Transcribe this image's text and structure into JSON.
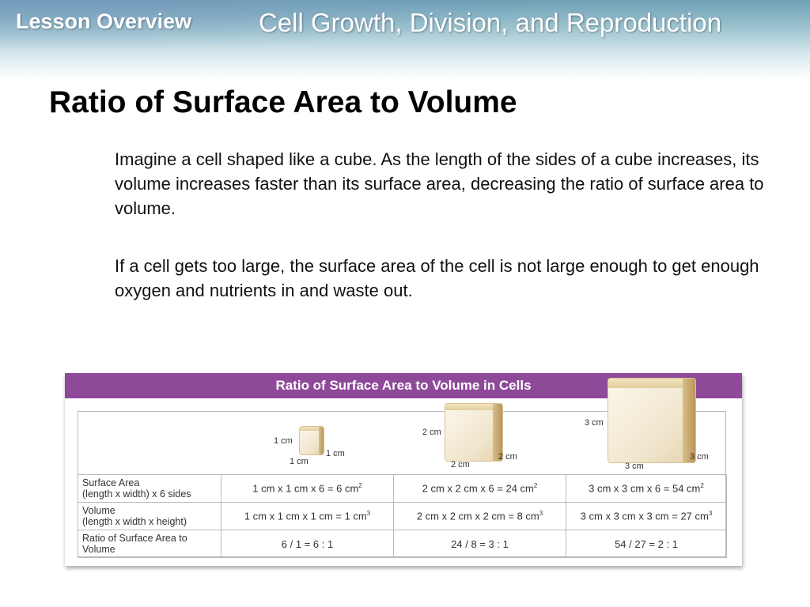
{
  "banner": {
    "left": "Lesson Overview",
    "right": "Cell Growth, Division, and Reproduction"
  },
  "slide": {
    "title": "Ratio of Surface Area to Volume",
    "paragraphs": [
      "Imagine a cell shaped like a cube. As the length of the sides of a cube increases, its volume increases faster than its surface area, decreasing the ratio of surface area to volume.",
      "If a cell gets too large, the surface area of the cell is not large enough to get enough oxygen and nutrients in and waste out."
    ]
  },
  "figure": {
    "title": "Ratio of Surface Area to Volume in Cells",
    "cubes": [
      {
        "side": "1 cm",
        "front": "1 cm",
        "bottom": "1 cm"
      },
      {
        "side": "2 cm",
        "front": "2 cm",
        "bottom": "2 cm"
      },
      {
        "side": "3 cm",
        "front": "3 cm",
        "bottom": "3 cm"
      }
    ],
    "rows": [
      {
        "label_line1": "Surface Area",
        "label_line2": "(length x width) x 6 sides",
        "cells": [
          {
            "text": "1 cm x 1 cm x 6 = 6 cm",
            "sup": "2"
          },
          {
            "text": "2 cm x 2 cm x 6 = 24 cm",
            "sup": "2"
          },
          {
            "text": "3 cm x 3 cm x 6 = 54 cm",
            "sup": "2"
          }
        ]
      },
      {
        "label_line1": "Volume",
        "label_line2": "(length x width x height)",
        "cells": [
          {
            "text": "1 cm x 1 cm x 1 cm = 1 cm",
            "sup": "3"
          },
          {
            "text": "2 cm x 2 cm x 2 cm = 8 cm",
            "sup": "3"
          },
          {
            "text": "3 cm x 3 cm x 3 cm = 27 cm",
            "sup": "3"
          }
        ]
      },
      {
        "label_line1": "Ratio of Surface Area to",
        "label_line2": "Volume",
        "cells": [
          {
            "text": "6 / 1 = 6 : 1"
          },
          {
            "text": "24 / 8 = 3 : 1"
          },
          {
            "text": "54 / 27 = 2 : 1"
          }
        ]
      }
    ]
  },
  "colors": {
    "header_purple": "#8e4a99",
    "banner_teal": "#6e9fb6"
  }
}
